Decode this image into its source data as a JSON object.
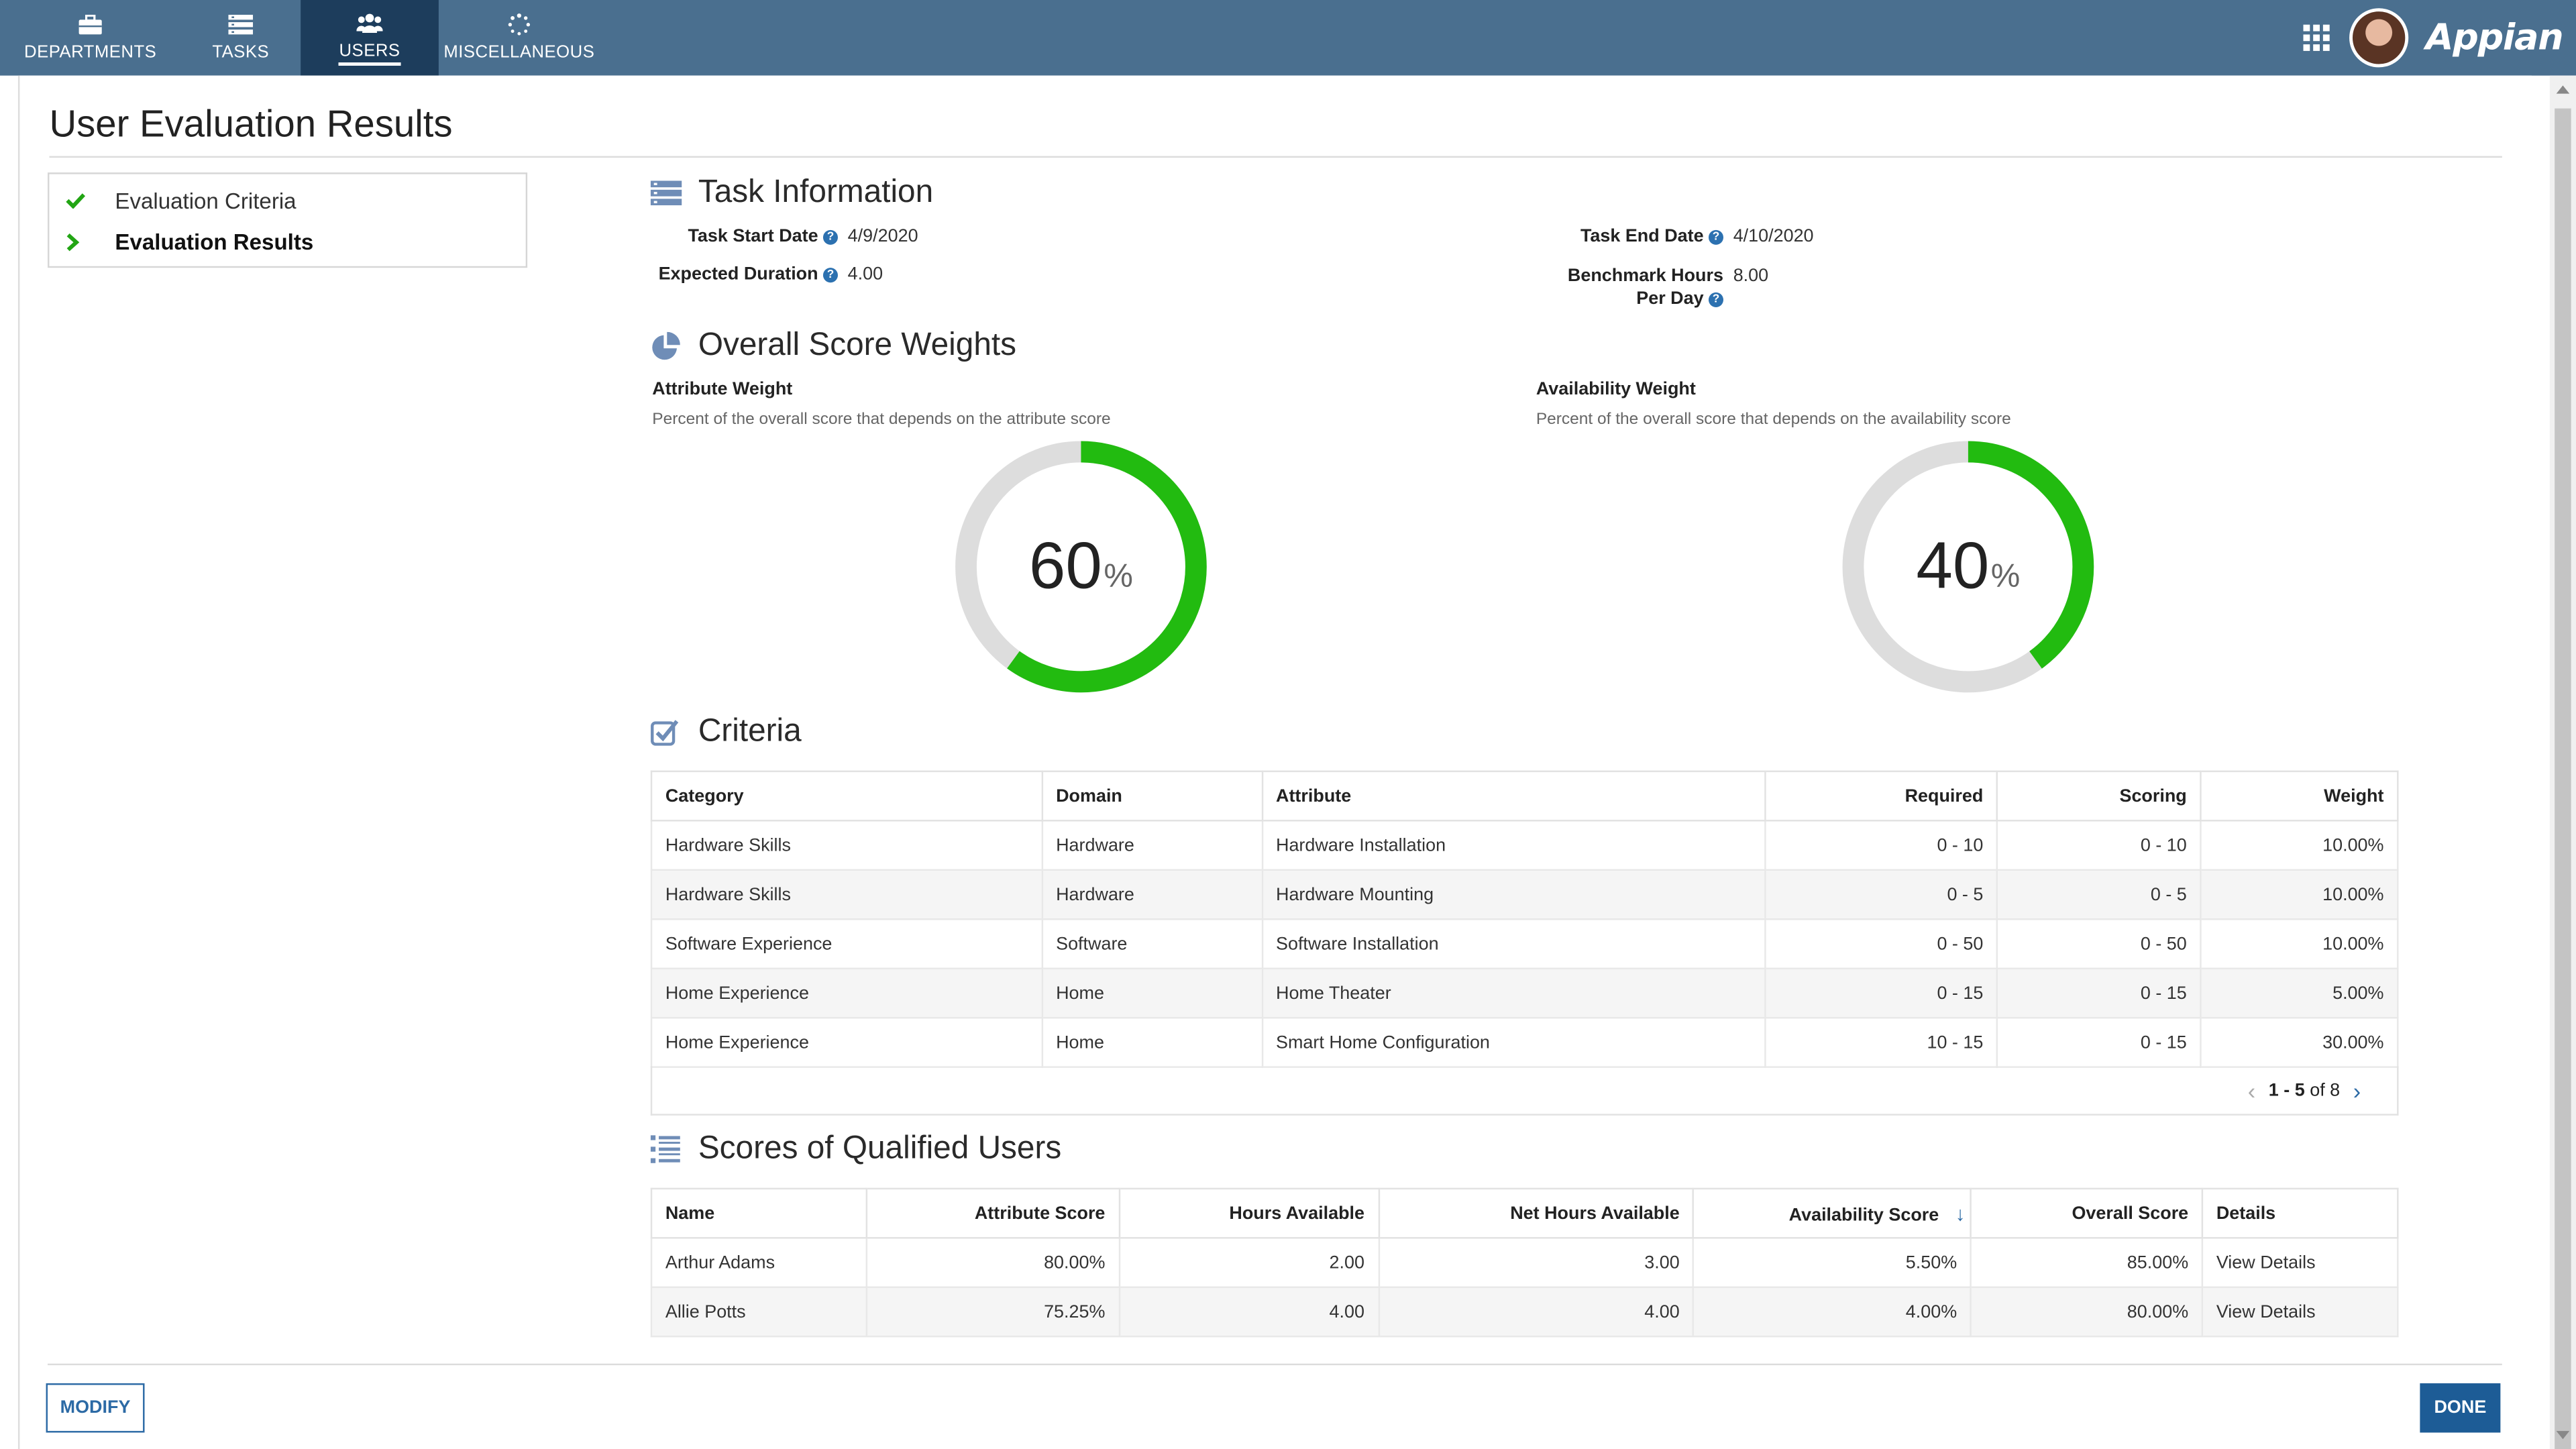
{
  "nav": {
    "tabs": [
      {
        "label": "DEPARTMENTS",
        "icon": "briefcase-icon"
      },
      {
        "label": "TASKS",
        "icon": "tasks-icon"
      },
      {
        "label": "USERS",
        "icon": "users-icon",
        "active": true
      },
      {
        "label": "MISCELLANEOUS",
        "icon": "spinner-icon"
      }
    ],
    "brand": "Appian"
  },
  "page": {
    "title": "User Evaluation Results"
  },
  "steps": [
    {
      "label": "Evaluation Criteria",
      "state": "complete"
    },
    {
      "label": "Evaluation Results",
      "state": "current"
    }
  ],
  "task_info": {
    "title": "Task Information",
    "start_date_label": "Task Start Date",
    "start_date": "4/9/2020",
    "end_date_label": "Task End Date",
    "end_date": "4/10/2020",
    "duration_label": "Expected Duration",
    "duration": "4.00",
    "benchmark_label_1": "Benchmark Hours",
    "benchmark_label_2": "Per Day",
    "benchmark": "8.00"
  },
  "weights": {
    "title": "Overall Score Weights",
    "attribute": {
      "label": "Attribute Weight",
      "description": "Percent of the overall score that depends on the attribute score",
      "value": "60",
      "fraction": 0.6,
      "unit": "%"
    },
    "availability": {
      "label": "Availability Weight",
      "description": "Percent of the overall score that depends on the availability score",
      "value": "40",
      "fraction": 0.4,
      "unit": "%"
    },
    "colors": {
      "fill": "#22bb10",
      "track": "#dddddd"
    }
  },
  "criteria": {
    "title": "Criteria",
    "headers": [
      "Category",
      "Domain",
      "Attribute",
      "Required",
      "Scoring",
      "Weight"
    ],
    "rows": [
      [
        "Hardware Skills",
        "Hardware",
        "Hardware Installation",
        "0 - 10",
        "0 - 10",
        "10.00%"
      ],
      [
        "Hardware Skills",
        "Hardware",
        "Hardware Mounting",
        "0 - 5",
        "0 - 5",
        "10.00%"
      ],
      [
        "Software Experience",
        "Software",
        "Software Installation",
        "0 - 50",
        "0 - 50",
        "10.00%"
      ],
      [
        "Home Experience",
        "Home",
        "Home Theater",
        "0 - 15",
        "0 - 15",
        "5.00%"
      ],
      [
        "Home Experience",
        "Home",
        "Smart Home Configuration",
        "10 - 15",
        "0 - 15",
        "30.00%"
      ]
    ],
    "pager": {
      "range": "1 - 5",
      "of": "of 8"
    }
  },
  "scores": {
    "title": "Scores of Qualified Users",
    "headers": [
      "Name",
      "Attribute Score",
      "Hours Available",
      "Net Hours Available",
      "Availability Score",
      "Overall Score",
      "Details"
    ],
    "rows": [
      [
        "Arthur Adams",
        "80.00%",
        "2.00",
        "3.00",
        "5.50%",
        "85.00%",
        "View Details"
      ],
      [
        "Allie Potts",
        "75.25%",
        "4.00",
        "4.00",
        "4.00%",
        "80.00%",
        "View Details"
      ]
    ]
  },
  "buttons": {
    "modify": "MODIFY",
    "done": "DONE"
  }
}
